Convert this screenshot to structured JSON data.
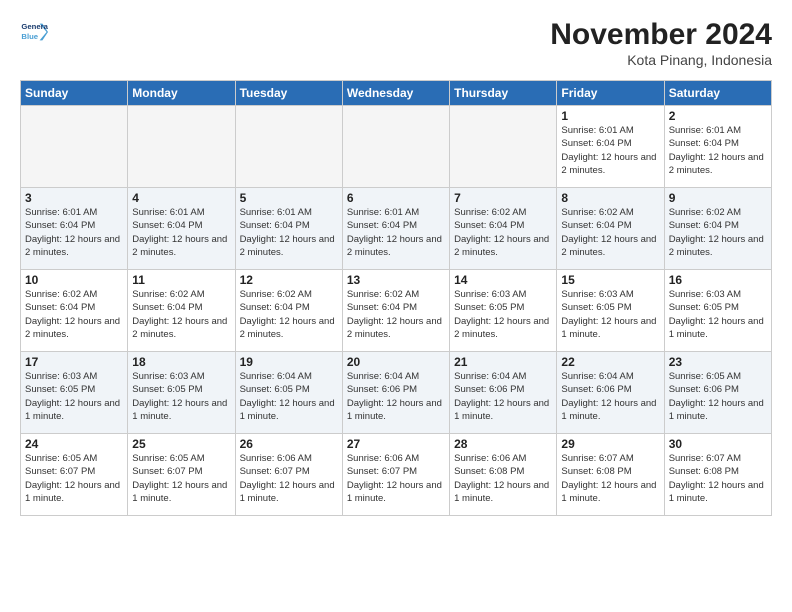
{
  "header": {
    "logo_line1": "General",
    "logo_line2": "Blue",
    "month_title": "November 2024",
    "location": "Kota Pinang, Indonesia"
  },
  "weekdays": [
    "Sunday",
    "Monday",
    "Tuesday",
    "Wednesday",
    "Thursday",
    "Friday",
    "Saturday"
  ],
  "weeks": [
    [
      {
        "day": "",
        "info": ""
      },
      {
        "day": "",
        "info": ""
      },
      {
        "day": "",
        "info": ""
      },
      {
        "day": "",
        "info": ""
      },
      {
        "day": "",
        "info": ""
      },
      {
        "day": "1",
        "info": "Sunrise: 6:01 AM\nSunset: 6:04 PM\nDaylight: 12 hours and 2 minutes."
      },
      {
        "day": "2",
        "info": "Sunrise: 6:01 AM\nSunset: 6:04 PM\nDaylight: 12 hours and 2 minutes."
      }
    ],
    [
      {
        "day": "3",
        "info": "Sunrise: 6:01 AM\nSunset: 6:04 PM\nDaylight: 12 hours and 2 minutes."
      },
      {
        "day": "4",
        "info": "Sunrise: 6:01 AM\nSunset: 6:04 PM\nDaylight: 12 hours and 2 minutes."
      },
      {
        "day": "5",
        "info": "Sunrise: 6:01 AM\nSunset: 6:04 PM\nDaylight: 12 hours and 2 minutes."
      },
      {
        "day": "6",
        "info": "Sunrise: 6:01 AM\nSunset: 6:04 PM\nDaylight: 12 hours and 2 minutes."
      },
      {
        "day": "7",
        "info": "Sunrise: 6:02 AM\nSunset: 6:04 PM\nDaylight: 12 hours and 2 minutes."
      },
      {
        "day": "8",
        "info": "Sunrise: 6:02 AM\nSunset: 6:04 PM\nDaylight: 12 hours and 2 minutes."
      },
      {
        "day": "9",
        "info": "Sunrise: 6:02 AM\nSunset: 6:04 PM\nDaylight: 12 hours and 2 minutes."
      }
    ],
    [
      {
        "day": "10",
        "info": "Sunrise: 6:02 AM\nSunset: 6:04 PM\nDaylight: 12 hours and 2 minutes."
      },
      {
        "day": "11",
        "info": "Sunrise: 6:02 AM\nSunset: 6:04 PM\nDaylight: 12 hours and 2 minutes."
      },
      {
        "day": "12",
        "info": "Sunrise: 6:02 AM\nSunset: 6:04 PM\nDaylight: 12 hours and 2 minutes."
      },
      {
        "day": "13",
        "info": "Sunrise: 6:02 AM\nSunset: 6:04 PM\nDaylight: 12 hours and 2 minutes."
      },
      {
        "day": "14",
        "info": "Sunrise: 6:03 AM\nSunset: 6:05 PM\nDaylight: 12 hours and 2 minutes."
      },
      {
        "day": "15",
        "info": "Sunrise: 6:03 AM\nSunset: 6:05 PM\nDaylight: 12 hours and 1 minute."
      },
      {
        "day": "16",
        "info": "Sunrise: 6:03 AM\nSunset: 6:05 PM\nDaylight: 12 hours and 1 minute."
      }
    ],
    [
      {
        "day": "17",
        "info": "Sunrise: 6:03 AM\nSunset: 6:05 PM\nDaylight: 12 hours and 1 minute."
      },
      {
        "day": "18",
        "info": "Sunrise: 6:03 AM\nSunset: 6:05 PM\nDaylight: 12 hours and 1 minute."
      },
      {
        "day": "19",
        "info": "Sunrise: 6:04 AM\nSunset: 6:05 PM\nDaylight: 12 hours and 1 minute."
      },
      {
        "day": "20",
        "info": "Sunrise: 6:04 AM\nSunset: 6:06 PM\nDaylight: 12 hours and 1 minute."
      },
      {
        "day": "21",
        "info": "Sunrise: 6:04 AM\nSunset: 6:06 PM\nDaylight: 12 hours and 1 minute."
      },
      {
        "day": "22",
        "info": "Sunrise: 6:04 AM\nSunset: 6:06 PM\nDaylight: 12 hours and 1 minute."
      },
      {
        "day": "23",
        "info": "Sunrise: 6:05 AM\nSunset: 6:06 PM\nDaylight: 12 hours and 1 minute."
      }
    ],
    [
      {
        "day": "24",
        "info": "Sunrise: 6:05 AM\nSunset: 6:07 PM\nDaylight: 12 hours and 1 minute."
      },
      {
        "day": "25",
        "info": "Sunrise: 6:05 AM\nSunset: 6:07 PM\nDaylight: 12 hours and 1 minute."
      },
      {
        "day": "26",
        "info": "Sunrise: 6:06 AM\nSunset: 6:07 PM\nDaylight: 12 hours and 1 minute."
      },
      {
        "day": "27",
        "info": "Sunrise: 6:06 AM\nSunset: 6:07 PM\nDaylight: 12 hours and 1 minute."
      },
      {
        "day": "28",
        "info": "Sunrise: 6:06 AM\nSunset: 6:08 PM\nDaylight: 12 hours and 1 minute."
      },
      {
        "day": "29",
        "info": "Sunrise: 6:07 AM\nSunset: 6:08 PM\nDaylight: 12 hours and 1 minute."
      },
      {
        "day": "30",
        "info": "Sunrise: 6:07 AM\nSunset: 6:08 PM\nDaylight: 12 hours and 1 minute."
      }
    ]
  ]
}
